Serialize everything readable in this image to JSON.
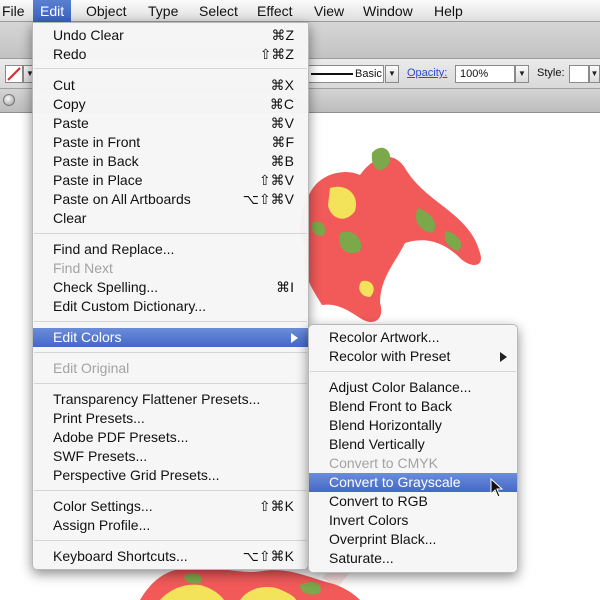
{
  "menubar": {
    "items": [
      "File",
      "Edit",
      "Object",
      "Type",
      "Select",
      "Effect",
      "View",
      "Window",
      "Help"
    ]
  },
  "controlbar": {
    "stroke_style": "Basic",
    "opacity_label": "Opacity:",
    "opacity_value": "100%",
    "style_label": "Style:"
  },
  "edit_menu": {
    "items": [
      {
        "label": "Undo Clear",
        "shortcut": "⌘Z"
      },
      {
        "label": "Redo",
        "shortcut": "⇧⌘Z"
      },
      {
        "label": "Cut",
        "shortcut": "⌘X"
      },
      {
        "label": "Copy",
        "shortcut": "⌘C"
      },
      {
        "label": "Paste",
        "shortcut": "⌘V"
      },
      {
        "label": "Paste in Front",
        "shortcut": "⌘F"
      },
      {
        "label": "Paste in Back",
        "shortcut": "⌘B"
      },
      {
        "label": "Paste in Place",
        "shortcut": "⇧⌘V"
      },
      {
        "label": "Paste on All Artboards",
        "shortcut": "⌥⇧⌘V"
      },
      {
        "label": "Clear",
        "shortcut": ""
      },
      {
        "label": "Find and Replace...",
        "shortcut": ""
      },
      {
        "label": "Find Next",
        "shortcut": ""
      },
      {
        "label": "Check Spelling...",
        "shortcut": "⌘I"
      },
      {
        "label": "Edit Custom Dictionary...",
        "shortcut": ""
      },
      {
        "label": "Edit Colors",
        "shortcut": ""
      },
      {
        "label": "Edit Original",
        "shortcut": ""
      },
      {
        "label": "Transparency Flattener Presets...",
        "shortcut": ""
      },
      {
        "label": "Print Presets...",
        "shortcut": ""
      },
      {
        "label": "Adobe PDF Presets...",
        "shortcut": ""
      },
      {
        "label": "SWF Presets...",
        "shortcut": ""
      },
      {
        "label": "Perspective Grid Presets...",
        "shortcut": ""
      },
      {
        "label": "Color Settings...",
        "shortcut": "⇧⌘K"
      },
      {
        "label": "Assign Profile...",
        "shortcut": ""
      },
      {
        "label": "Keyboard Shortcuts...",
        "shortcut": "⌥⇧⌘K"
      }
    ]
  },
  "colors_submenu": {
    "items": [
      {
        "label": "Recolor Artwork..."
      },
      {
        "label": "Recolor with Preset"
      },
      {
        "label": "Adjust Color Balance..."
      },
      {
        "label": "Blend Front to Back"
      },
      {
        "label": "Blend Horizontally"
      },
      {
        "label": "Blend Vertically"
      },
      {
        "label": "Convert to CMYK"
      },
      {
        "label": "Convert to Grayscale"
      },
      {
        "label": "Convert to RGB"
      },
      {
        "label": "Invert Colors"
      },
      {
        "label": "Overprint Black..."
      },
      {
        "label": "Saturate..."
      }
    ]
  },
  "colors": {
    "highlight": "#4a6fcb",
    "artwork_red": "#f25a5a",
    "artwork_green": "#7aa84a",
    "artwork_yellow": "#f3e35a"
  }
}
